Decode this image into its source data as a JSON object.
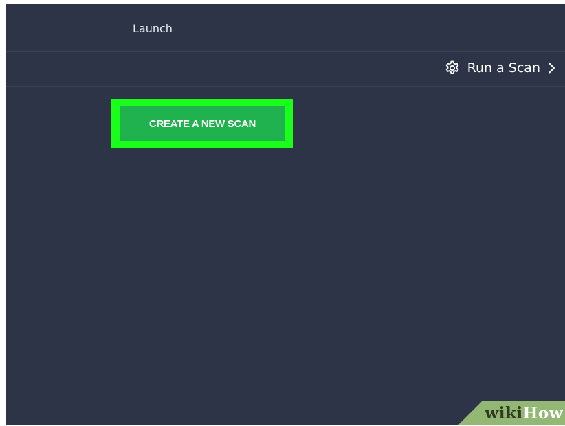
{
  "header": {
    "launch_label": "Launch"
  },
  "scan_bar": {
    "run_scan_label": "Run a Scan",
    "gear_icon": "gear-icon",
    "chevron_icon": "chevron-right-icon"
  },
  "main": {
    "create_button_label": "CREATE A NEW SCAN"
  },
  "watermark": {
    "part1": "wiki",
    "part2": "How"
  },
  "colors": {
    "background": "#2d3448",
    "button": "#1fb24e",
    "highlight": "#1aff1a",
    "watermark": "#93b874"
  }
}
